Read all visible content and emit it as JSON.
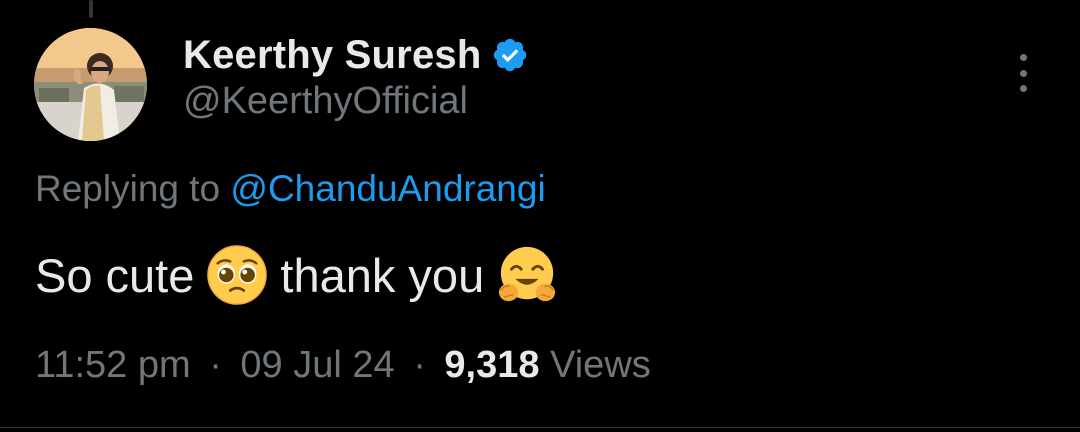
{
  "author": {
    "display_name": "Keerthy Suresh",
    "handle": "@KeerthyOfficial",
    "verified": true
  },
  "reply": {
    "prefix": "Replying to",
    "mention": "@ChanduAndrangi"
  },
  "tweet": {
    "text_part1": "So cute",
    "emoji1": "pleading-face",
    "text_part2": "thank you",
    "emoji2": "hugging-face"
  },
  "meta": {
    "time": "11:52 pm",
    "separator": "·",
    "date": "09 Jul 24",
    "views_count": "9,318",
    "views_label": "Views"
  },
  "colors": {
    "background": "#000000",
    "primary_text": "#e7e9ea",
    "secondary_text": "#71767b",
    "link": "#1d9bf0"
  }
}
